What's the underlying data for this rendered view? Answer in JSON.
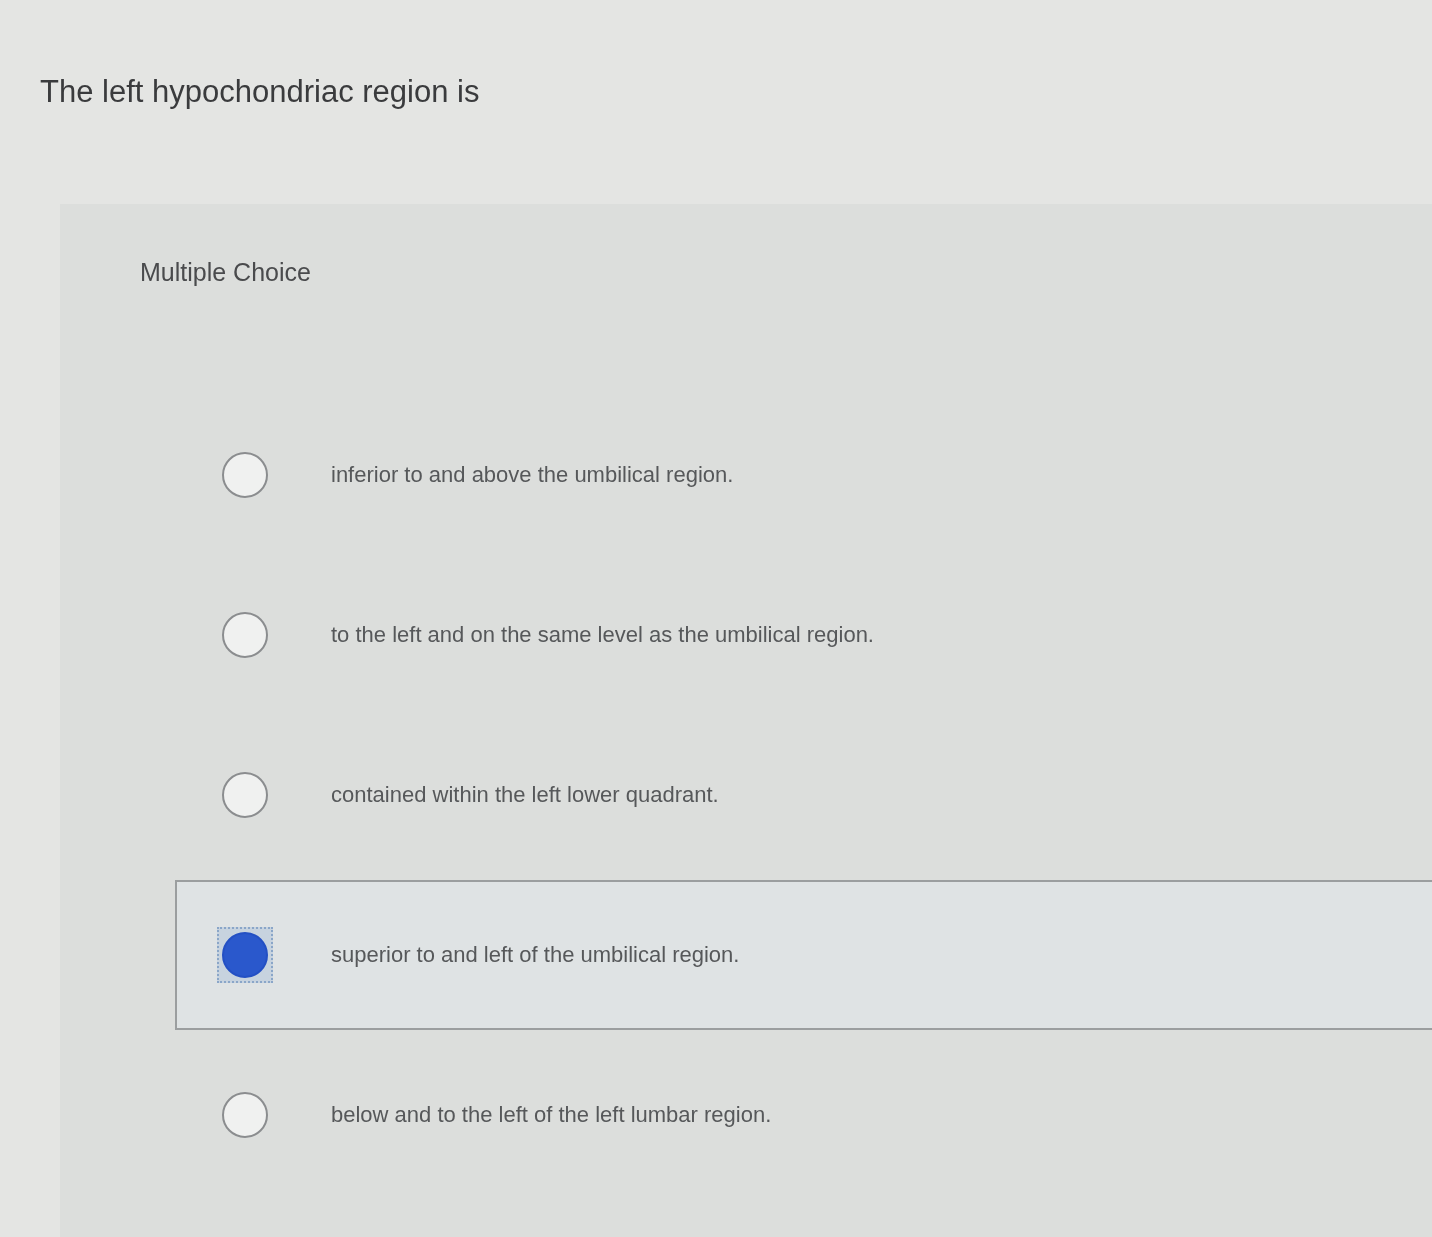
{
  "question": {
    "text": "The left hypochondriac region is"
  },
  "section": {
    "label": "Multiple Choice"
  },
  "options": [
    {
      "text": "inferior to and above the umbilical region.",
      "selected": false
    },
    {
      "text": "to the left and on the same level as the umbilical region.",
      "selected": false
    },
    {
      "text": "contained within the left lower quadrant.",
      "selected": false
    },
    {
      "text": "superior to and left of the umbilical region.",
      "selected": true
    },
    {
      "text": "below and to the left of the left lumbar region.",
      "selected": false
    }
  ]
}
